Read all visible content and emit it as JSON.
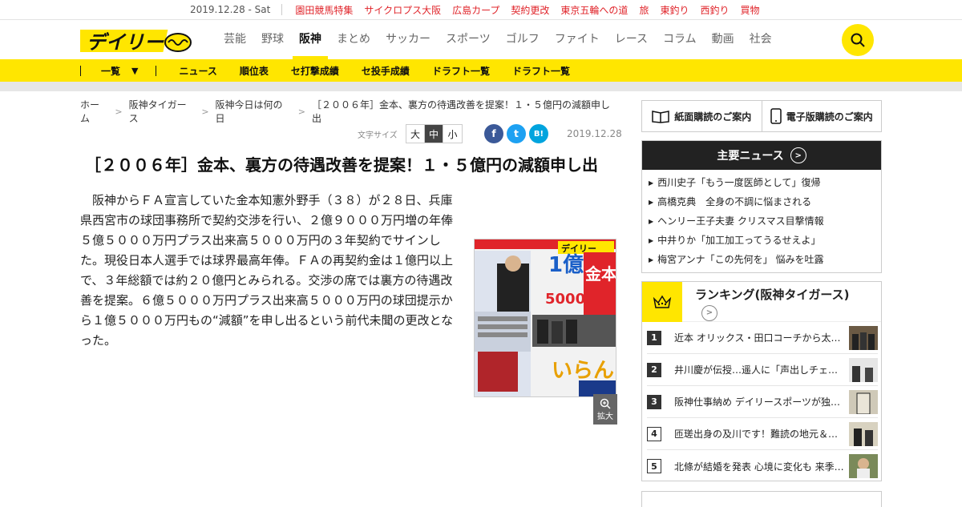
{
  "topbar": {
    "date": "2019.12.28 - Sat",
    "links": [
      "園田競馬特集",
      "サイクロプス大阪",
      "広島カープ",
      "契約更改",
      "東京五輪への道",
      "旅",
      "東釣り",
      "西釣り",
      "買物"
    ]
  },
  "header": {
    "logo_text": "デイリー",
    "nav": [
      "芸能",
      "野球",
      "阪神",
      "まとめ",
      "サッカー",
      "スポーツ",
      "ゴルフ",
      "ファイト",
      "レース",
      "コラム",
      "動画",
      "社会"
    ],
    "active_nav": "阪神",
    "search_icon": "search-icon"
  },
  "subnav": {
    "list_label": "一覧",
    "items": [
      "ニュース",
      "順位表",
      "セ打撃成績",
      "セ投手成績",
      "ドラフト一覧",
      "ドラフト一覧"
    ]
  },
  "breadcrumb": [
    "ホーム",
    "阪神タイガース",
    "阪神今日は何の日",
    "［２００６年］金本、裏方の待遇改善を提案！１・５億円の減額申し出"
  ],
  "tools": {
    "font_size_label": "文字サイズ",
    "font_sizes": [
      "大",
      "中",
      "小"
    ],
    "selected_size": "中",
    "sns": [
      "f",
      "t",
      "B!"
    ],
    "date": "2019.12.28"
  },
  "article": {
    "title": "［２００６年］金本、裏方の待遇改善を提案！１・５億円の減額申し出",
    "body": "阪神からＦＡ宣言していた金本知憲外野手（３８）が２８日、兵庫県西宮市の球団事務所で契約交渉を行い、２億９０００万円増の年俸５億５０００万円プラス出来高５０００万円の３年契約でサインした。現役日本人選手では球界最高年俸。ＦＡの再契約金は１億円以上で、３年総額では約２０億円とみられる。交渉の席では裏方の待遇改善を提案。６億５０００万円プラス出来高５０００万円の球団提示から１億５０００万円もの“減額”を申し出るという前代未聞の更改となった。",
    "zoom_label": "拡大",
    "photo_texts": [
      "デイリー",
      "1億",
      "5000万",
      "金本",
      "いらん"
    ]
  },
  "sidebar": {
    "subscribe": [
      "紙面購読のご案内",
      "電子版購読のご案内"
    ],
    "news_title": "主要ニュース",
    "news": [
      "西川史子「もう一度医師として」復帰",
      "高橋克典　全身の不調に悩まされる",
      "ヘンリー王子夫妻 クリスマス目撃情報",
      "中井りか「加工加工ってうるせえよ」",
      "梅宮アンナ「この先何を」 悩みを吐露"
    ],
    "ranking_title": "ランキング(阪神タイガース)",
    "ranking": [
      {
        "rank": "1",
        "text": "近本 オリックス・田口コーチから太…"
      },
      {
        "rank": "2",
        "text": "井川慶が伝授…遥人に「声出しチェン…"
      },
      {
        "rank": "3",
        "text": "阪神仕事納め デイリースポーツが独…"
      },
      {
        "rank": "4",
        "text": "匝瑳出身の及川です！難読の地元＆自…"
      },
      {
        "rank": "5",
        "text": "北條が結婚を発表 心境に変化も 来季…"
      }
    ]
  },
  "colors": {
    "brand_yellow": "#ffe600",
    "topbar_red": "#e0242a",
    "dark": "#222222"
  }
}
